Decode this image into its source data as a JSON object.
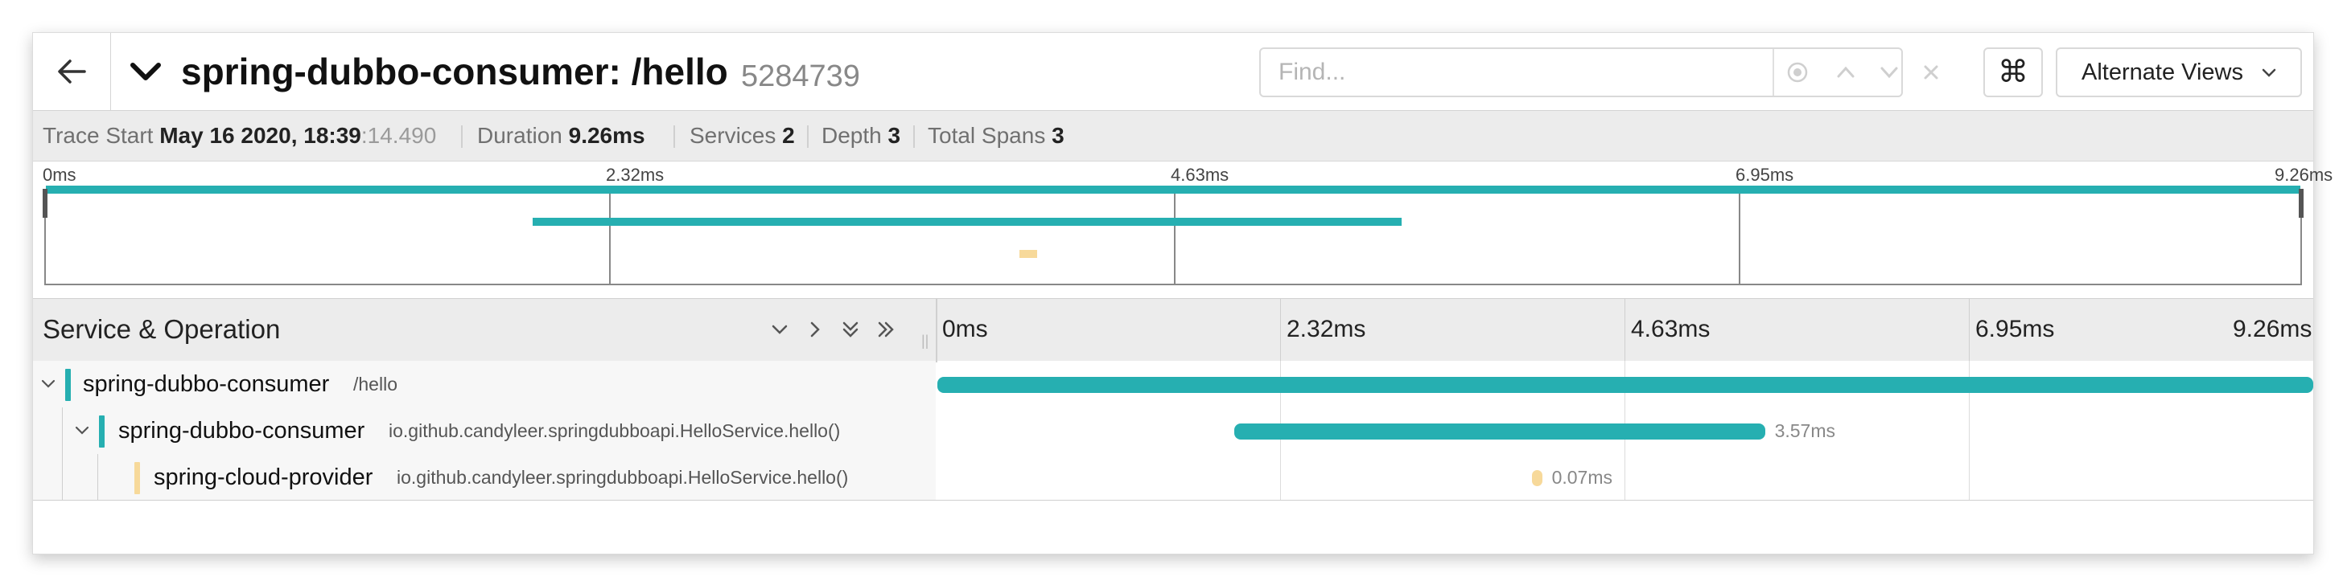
{
  "header": {
    "title": "spring-dubbo-consumer: /hello",
    "trace_id": "5284739",
    "find_placeholder": "Find...",
    "cmd_symbol": "⌘",
    "alternate_views_label": "Alternate Views"
  },
  "info": {
    "trace_start_label": "Trace Start",
    "trace_start_date": "May 16 2020, 18:39",
    "trace_start_ms": ":14.490",
    "duration_label": "Duration",
    "duration_value": "9.26ms",
    "services_label": "Services",
    "services_value": "2",
    "depth_label": "Depth",
    "depth_value": "3",
    "total_spans_label": "Total Spans",
    "total_spans_value": "3"
  },
  "minimap": {
    "ticks": [
      "0ms",
      "2.32ms",
      "4.63ms",
      "6.95ms",
      "9.26ms"
    ]
  },
  "span_header": {
    "title": "Service & Operation",
    "ticks": [
      "0ms",
      "2.32ms",
      "4.63ms",
      "6.95ms",
      "9.26ms"
    ]
  },
  "colors": {
    "consumer": "#26afb1",
    "provider": "#f7d99a"
  },
  "total_ms": 9.26,
  "spans": [
    {
      "service": "spring-dubbo-consumer",
      "operation": "/hello",
      "start_ms": 0.0,
      "duration_ms": 9.26,
      "duration_label": "",
      "depth": 0,
      "color": "#26afb1",
      "expandable": true
    },
    {
      "service": "spring-dubbo-consumer",
      "operation": "io.github.candyleer.springdubboapi.HelloService.hello()",
      "start_ms": 2.0,
      "duration_ms": 3.57,
      "duration_label": "3.57ms",
      "depth": 1,
      "color": "#26afb1",
      "expandable": true
    },
    {
      "service": "spring-cloud-provider",
      "operation": "io.github.candyleer.springdubboapi.HelloService.hello()",
      "start_ms": 4.0,
      "duration_ms": 0.07,
      "duration_label": "0.07ms",
      "depth": 2,
      "color": "#f7d99a",
      "expandable": false
    }
  ]
}
